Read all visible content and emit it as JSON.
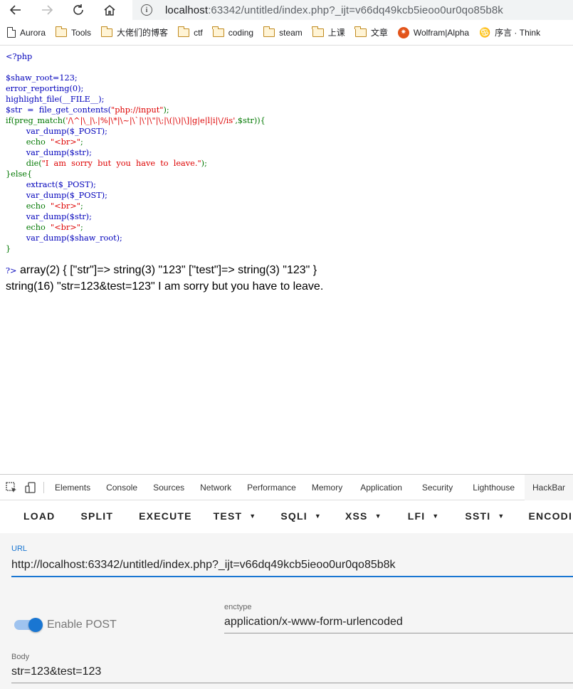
{
  "browser": {
    "url_host": "localhost",
    "url_rest": ":63342/untitled/index.php?_ijt=v66dq49kcb5ieoo0ur0qo85b8k",
    "info_glyph": "i"
  },
  "bookmarks": [
    {
      "label": "Aurora",
      "icon": "page-icon"
    },
    {
      "label": "Tools",
      "icon": "folder-icon"
    },
    {
      "label": "大佬们的博客",
      "icon": "folder-icon"
    },
    {
      "label": "ctf",
      "icon": "folder-icon"
    },
    {
      "label": "coding",
      "icon": "folder-icon"
    },
    {
      "label": "steam",
      "icon": "folder-icon"
    },
    {
      "label": "上课",
      "icon": "folder-icon"
    },
    {
      "label": "文章",
      "icon": "folder-icon"
    },
    {
      "label": "Wolfram|Alpha",
      "icon": "wolfram-icon"
    },
    {
      "label": "序言 · Think",
      "icon": "think-icon"
    }
  ],
  "code": {
    "open": "<?php",
    "l1": "$shaw_root=123;",
    "l2": "error_reporting(0);",
    "l3": "highlight_file(__FILE__);",
    "l4a": "$str  =  file_get_contents(",
    "l4b": "\"php://input\"",
    "l4c": ");",
    "l5a": "if(preg_match(",
    "l5b": "'/\\^|\\_|\\.|%|\\*|\\~|\\`|\\'|\\\"|\\;|\\(|\\)|\\]|g|e|l|i|\\//is'",
    "l5c": ",$str)){",
    "l6": "        var_dump($_POST);",
    "l7a": "        echo  ",
    "l7b": "\"<br>\"",
    "l7c": ";",
    "l8": "        var_dump($str);",
    "l9a": "        die(",
    "l9b": "\"I  am  sorry  but  you  have  to  leave.\"",
    "l9c": ");",
    "l10": "}else{",
    "l11": "        extract($_POST);",
    "l12": "        var_dump($_POST);",
    "l13a": "        echo  ",
    "l13b": "\"<br>\"",
    "l13c": ";",
    "l14": "        var_dump($str);",
    "l15a": "        echo  ",
    "l15b": "\"<br>\"",
    "l15c": ";",
    "l16": "        var_dump($shaw_root);",
    "l17": "}"
  },
  "output": {
    "close_tag": "?>",
    "line1": " array(2) { [\"str\"]=> string(3) \"123\" [\"test\"]=> string(3) \"123\" }",
    "line2": "string(16) \"str=123&test=123\" I am sorry but you have to leave."
  },
  "devtools": {
    "tabs": [
      "Elements",
      "Console",
      "Sources",
      "Network",
      "Performance",
      "Memory",
      "Application",
      "Security",
      "Lighthouse",
      "HackBar"
    ],
    "active_tab": "HackBar"
  },
  "hackbar": {
    "buttons": {
      "load": "LOAD",
      "split": "SPLIT",
      "execute": "EXECUTE",
      "test": "TEST",
      "sqli": "SQLI",
      "xss": "XSS",
      "lfi": "LFI",
      "ssti": "SSTI",
      "encoding": "ENCODING"
    },
    "url_label": "URL",
    "url_value": "http://localhost:63342/untitled/index.php?_ijt=v66dq49kcb5ieoo0ur0qo85b8k",
    "enable_post_label": "Enable POST",
    "enable_post": true,
    "enctype_label": "enctype",
    "enctype_value": "application/x-www-form-urlencoded",
    "body_label": "Body",
    "body_value": "str=123&test=123"
  }
}
